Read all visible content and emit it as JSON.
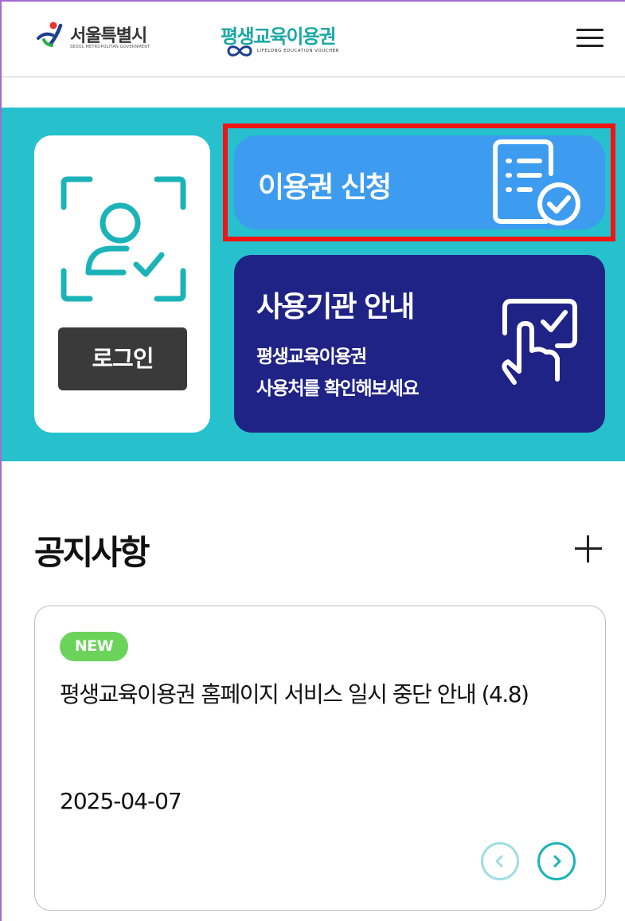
{
  "header": {
    "seoul_logo_text": "서울특별시",
    "seoul_logo_sub": "SEOUL METROPOLITAN GOVERNMENT",
    "voucher_logo_text": "평생교육이용권",
    "voucher_logo_sub": "LIFELONG EDUCATION VOUCHER",
    "menu_icon": "hamburger-menu-icon"
  },
  "banner": {
    "background_color": "#26c1cc",
    "login_label": "로그인",
    "login_icon": "face-scan-user-icon",
    "apply": {
      "title": "이용권 신청",
      "icon": "document-check-icon",
      "color": "#3d9cf0"
    },
    "places": {
      "title": "사용기관 안내",
      "desc_line1": "평생교육이용권",
      "desc_line2": "사용처를 확인해보세요",
      "icon": "touch-screen-check-icon",
      "color": "#1f2386"
    }
  },
  "notices": {
    "title": "공지사항",
    "more_icon": "plus-icon",
    "item": {
      "badge": "NEW",
      "title": "평생교육이용권 홈페이지 서비스 일시 중단 안내 (4.8)",
      "date": "2025-04-07"
    },
    "prev_icon": "chevron-left-icon",
    "next_icon": "chevron-right-icon"
  }
}
